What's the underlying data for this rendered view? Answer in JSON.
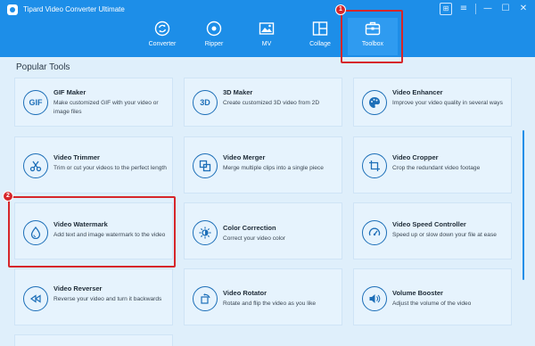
{
  "window": {
    "title": "Tipard Video Converter Ultimate",
    "controls": [
      "⊞",
      "≡",
      "—",
      "☐",
      "✕"
    ]
  },
  "nav": [
    {
      "label": "Converter",
      "icon": "converter-icon"
    },
    {
      "label": "Ripper",
      "icon": "ripper-icon"
    },
    {
      "label": "MV",
      "icon": "mv-icon"
    },
    {
      "label": "Collage",
      "icon": "collage-icon"
    },
    {
      "label": "Toolbox",
      "icon": "toolbox-icon",
      "active": true
    }
  ],
  "annotations": {
    "step1": "1",
    "step2": "2"
  },
  "section_title": "Popular Tools",
  "tools": [
    {
      "title": "GIF Maker",
      "desc": "Make customized GIF with your video or image files",
      "icon_text": "GIF",
      "icon": "gif-icon"
    },
    {
      "title": "3D Maker",
      "desc": "Create customized 3D video from 2D",
      "icon_text": "3D",
      "icon": "3d-icon"
    },
    {
      "title": "Video Enhancer",
      "desc": "Improve your video quality in several ways",
      "icon_text": "",
      "icon": "palette-icon"
    },
    {
      "title": "Video Trimmer",
      "desc": "Trim or cut your videos to the perfect length",
      "icon_text": "",
      "icon": "scissors-icon"
    },
    {
      "title": "Video Merger",
      "desc": "Merge multiple clips into a single piece",
      "icon_text": "",
      "icon": "merge-icon"
    },
    {
      "title": "Video Cropper",
      "desc": "Crop the redundant video footage",
      "icon_text": "",
      "icon": "crop-icon"
    },
    {
      "title": "Video Watermark",
      "desc": "Add text and image watermark to the video",
      "icon_text": "",
      "icon": "droplet-icon"
    },
    {
      "title": "Color Correction",
      "desc": "Correct your video color",
      "icon_text": "",
      "icon": "sun-icon"
    },
    {
      "title": "Video Speed Controller",
      "desc": "Speed up or slow down your file at ease",
      "icon_text": "",
      "icon": "speedometer-icon"
    },
    {
      "title": "Video Reverser",
      "desc": "Reverse your video and turn it backwards",
      "icon_text": "",
      "icon": "rewind-icon"
    },
    {
      "title": "Video Rotator",
      "desc": "Rotate and flip the video as you like",
      "icon_text": "",
      "icon": "rotate-icon"
    },
    {
      "title": "Volume Booster",
      "desc": "Adjust the volume of the video",
      "icon_text": "",
      "icon": "volume-icon"
    }
  ],
  "colors": {
    "topbar": "#1d8ee8",
    "background": "#dfeffb",
    "card": "#e6f3fd",
    "accent": "#1d6fb8",
    "highlight": "#d6262a"
  }
}
